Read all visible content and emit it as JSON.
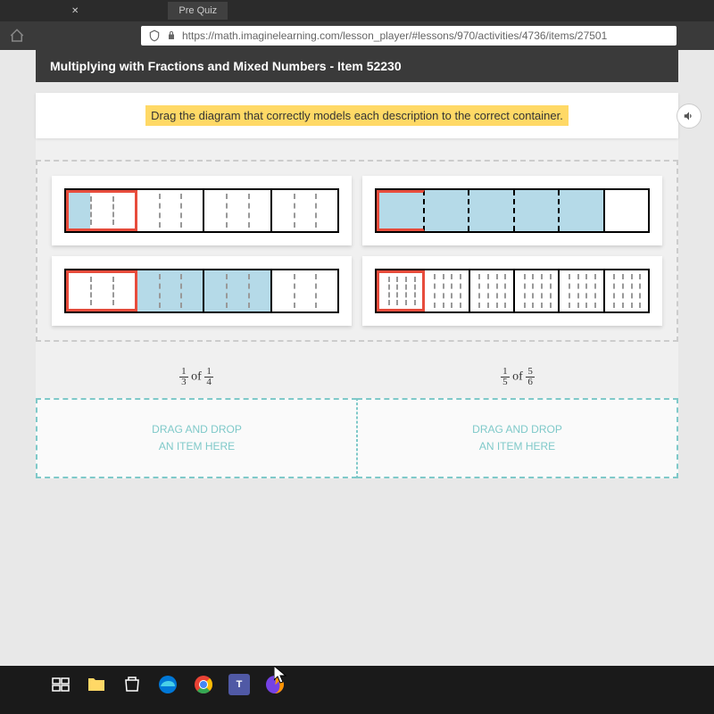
{
  "browser": {
    "tab_title": "Pre Quiz",
    "url": "https://math.imaginelearning.com/lesson_player/#lessons/970/activities/4736/items/27501"
  },
  "lesson": {
    "title": "Multiplying with Fractions and Mixed Numbers - Item 52230",
    "instruction": "Drag the diagram that correctly models each description to the correct container."
  },
  "drop_zones": [
    {
      "label_a_num": "1",
      "label_a_den": "3",
      "label_of": "of",
      "label_b_num": "1",
      "label_b_den": "4",
      "placeholder_line1": "DRAG AND DROP",
      "placeholder_line2": "AN ITEM HERE"
    },
    {
      "label_a_num": "1",
      "label_a_den": "5",
      "label_of": "of",
      "label_b_num": "5",
      "label_b_den": "6",
      "placeholder_line1": "DRAG AND DROP",
      "placeholder_line2": "AN ITEM HERE"
    }
  ]
}
